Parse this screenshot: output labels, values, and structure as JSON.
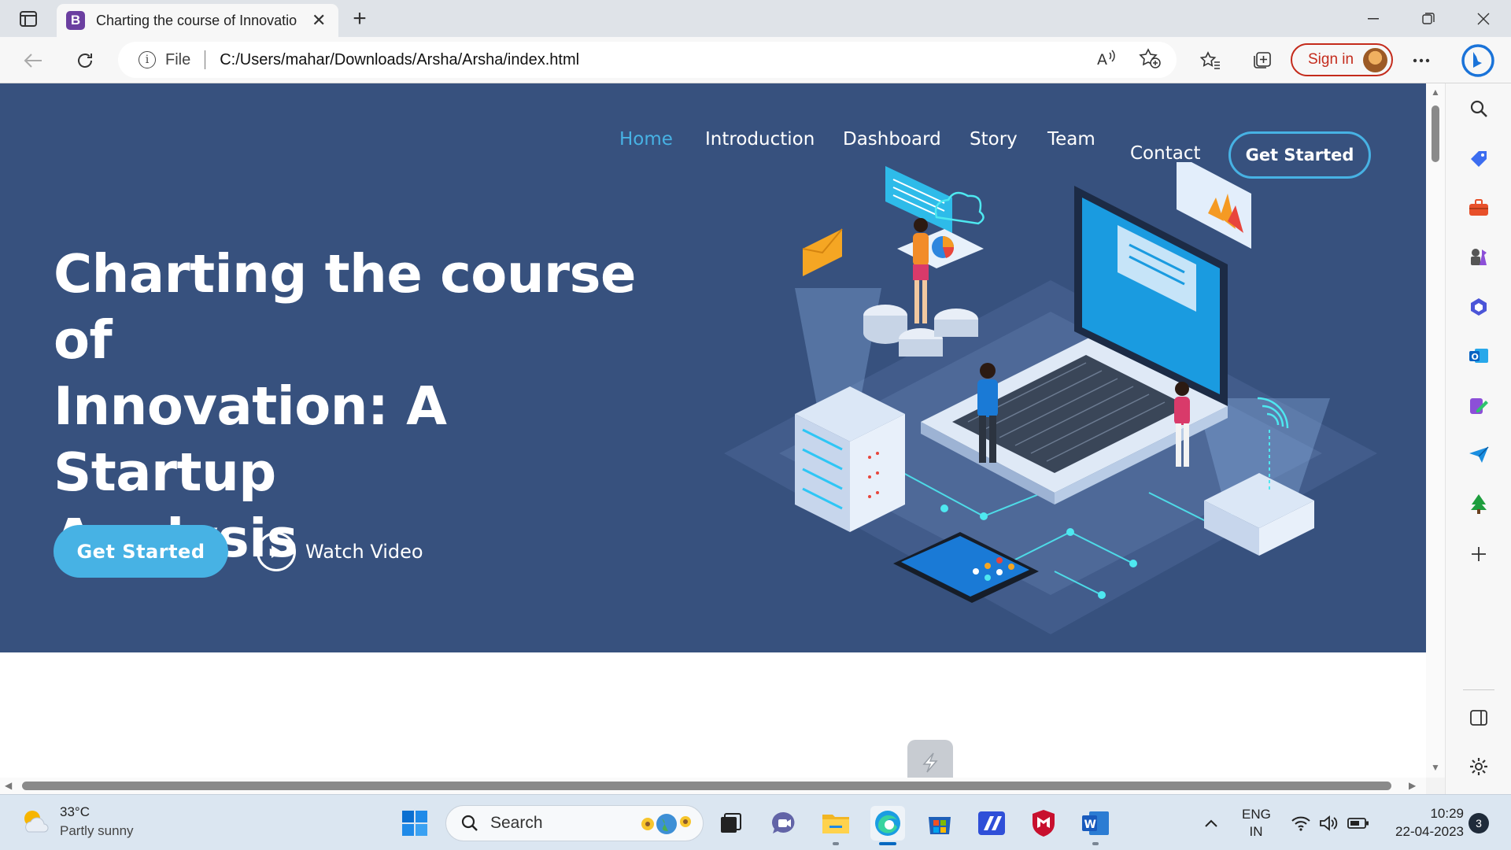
{
  "browser": {
    "tab_title": "Charting the course of Innovatio",
    "tab_favicon_letter": "B",
    "address_prefix": "File",
    "url": "C:/Users/mahar/Downloads/Arsha/Arsha/index.html",
    "sign_in_label": "Sign in"
  },
  "site": {
    "nav": {
      "home": "Home",
      "introduction": "Introduction",
      "dashboard": "Dashboard",
      "story": "Story",
      "team": "Team",
      "contact": "Contact",
      "cta": "Get Started"
    },
    "hero": {
      "title_line1": "Charting the course of",
      "title_line2": "Innovation: A Startup",
      "title_line3": "Analysis",
      "primary_button": "Get Started",
      "video_label": "Watch Video"
    },
    "colors": {
      "hero_bg": "#37517e",
      "accent": "#47b2e4"
    }
  },
  "taskbar": {
    "weather_temp": "33°C",
    "weather_condition": "Partly sunny",
    "search_label": "Search",
    "lang_line1": "ENG",
    "lang_line2": "IN",
    "time": "10:29",
    "date": "22-04-2023",
    "notification_count": "3"
  }
}
